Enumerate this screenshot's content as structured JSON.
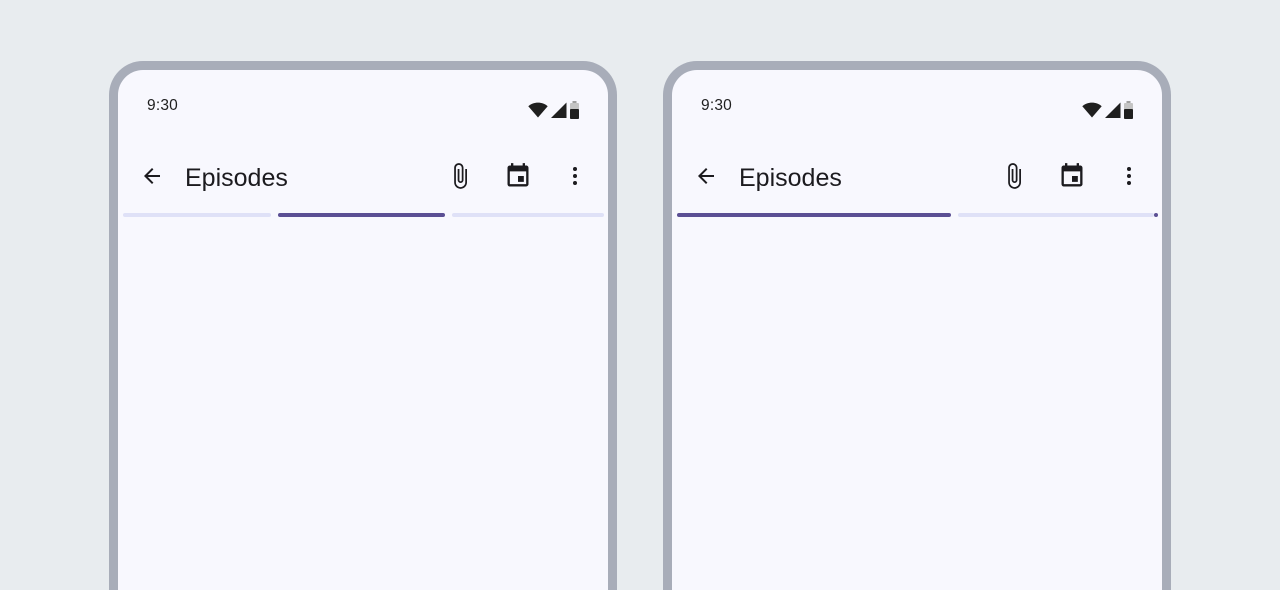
{
  "colors": {
    "background": "#e8ecef",
    "frame": "#a8adb9",
    "surface": "#f8f8fe",
    "progress_active": "#5b4f94",
    "progress_track": "#dfe1f7",
    "on_surface": "#1c1b1f"
  },
  "screens": [
    {
      "status_bar": {
        "time": "9:30",
        "icons": [
          "wifi-icon",
          "cellular-signal-icon",
          "battery-icon"
        ]
      },
      "app_bar": {
        "title": "Episodes",
        "navigation_icon": "arrow-back-icon",
        "actions": [
          "attach-icon",
          "calendar-event-icon",
          "more-vert-icon"
        ]
      },
      "progress": {
        "segments": 3,
        "active_segment": 2,
        "active_fraction": 0.33
      }
    },
    {
      "status_bar": {
        "time": "9:30",
        "icons": [
          "wifi-icon",
          "cellular-signal-icon",
          "battery-icon"
        ]
      },
      "app_bar": {
        "title": "Episodes",
        "navigation_icon": "arrow-back-icon",
        "actions": [
          "attach-icon",
          "calendar-event-icon",
          "more-vert-icon"
        ]
      },
      "progress": {
        "type": "linear-determinate",
        "value": 0.58,
        "stop_indicator": true
      }
    }
  ]
}
